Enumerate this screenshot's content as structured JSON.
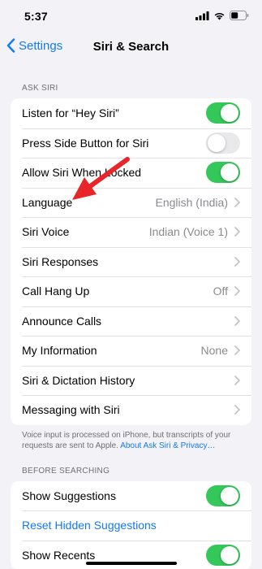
{
  "status_bar": {
    "time": "5:37"
  },
  "nav": {
    "back_label": "Settings",
    "title": "Siri & Search"
  },
  "ask_siri": {
    "header": "ASK SIRI",
    "rows": [
      {
        "label": "Listen for “Hey Siri”",
        "toggle": true
      },
      {
        "label": "Press Side Button for Siri",
        "toggle": false
      },
      {
        "label": "Allow Siri When Locked",
        "toggle": true
      },
      {
        "label": "Language",
        "value": "English (India)"
      },
      {
        "label": "Siri Voice",
        "value": "Indian (Voice 1)"
      },
      {
        "label": "Siri Responses",
        "value": ""
      },
      {
        "label": "Call Hang Up",
        "value": "Off"
      },
      {
        "label": "Announce Calls",
        "value": ""
      },
      {
        "label": "My Information",
        "value": "None"
      },
      {
        "label": "Siri & Dictation History",
        "value": ""
      },
      {
        "label": "Messaging with Siri",
        "value": ""
      }
    ],
    "footnote_text": "Voice input is processed on iPhone, but transcripts of your requests are sent to Apple. ",
    "footnote_link": "About Ask Siri & Privacy…"
  },
  "before_searching": {
    "header": "BEFORE SEARCHING",
    "show_suggestions_label": "Show Suggestions",
    "show_suggestions_on": true,
    "reset_hidden_label": "Reset Hidden Suggestions",
    "show_recents_label": "Show Recents",
    "show_recents_on": true
  },
  "colors": {
    "accent": "#1479f6",
    "toggle_on": "#34c759",
    "annotation_arrow": "#e8262a"
  }
}
